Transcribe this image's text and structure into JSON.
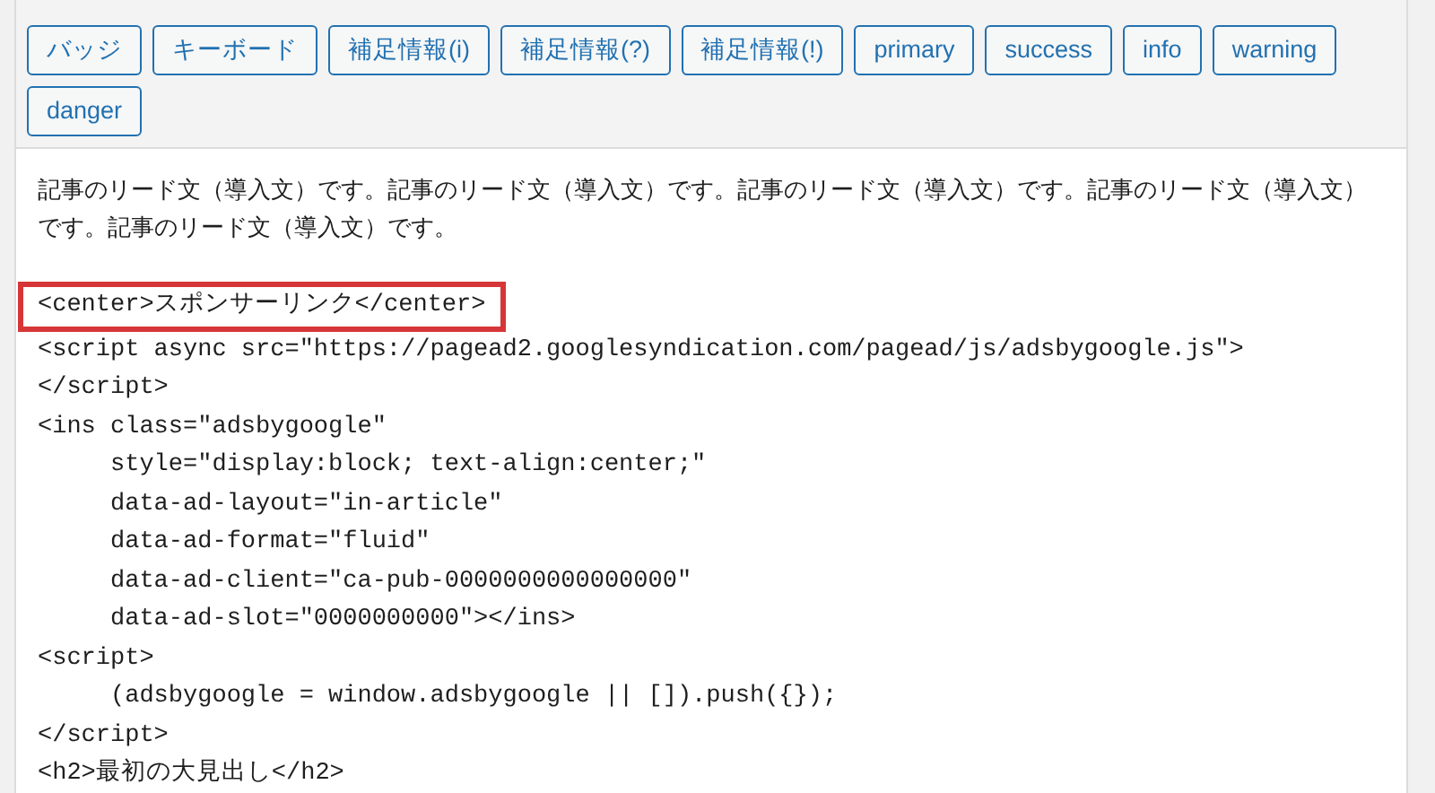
{
  "toolbar": {
    "buttons": [
      "バッジ",
      "キーボード",
      "補足情報(i)",
      "補足情報(?)",
      "補足情報(!)",
      "primary",
      "success",
      "info",
      "warning",
      "danger"
    ]
  },
  "editor": {
    "lead": "記事のリード文（導入文）です。記事のリード文（導入文）です。記事のリード文（導入文）です。記事のリード文（導入文）です。記事のリード文（導入文）です。",
    "code_lines": [
      {
        "text": "<center>スポンサーリンク</center>",
        "highlighted": true
      },
      {
        "text": "<script async src=\"https://pagead2.googlesyndication.com/pagead/js/adsbygoogle.js\">",
        "highlighted": false
      },
      {
        "text": "</script>",
        "highlighted": false
      },
      {
        "text": "<ins class=\"adsbygoogle\"",
        "highlighted": false
      },
      {
        "text": "     style=\"display:block; text-align:center;\"",
        "highlighted": false
      },
      {
        "text": "     data-ad-layout=\"in-article\"",
        "highlighted": false
      },
      {
        "text": "     data-ad-format=\"fluid\"",
        "highlighted": false
      },
      {
        "text": "     data-ad-client=\"ca-pub-0000000000000000\"",
        "highlighted": false
      },
      {
        "text": "     data-ad-slot=\"0000000000\"></ins>",
        "highlighted": false
      },
      {
        "text": "<script>",
        "highlighted": false
      },
      {
        "text": "     (adsbygoogle = window.adsbygoogle || []).push({});",
        "highlighted": false
      },
      {
        "text": "</script>",
        "highlighted": false
      },
      {
        "text": "<h2>最初の大見出し</h2>",
        "highlighted": false
      }
    ]
  }
}
